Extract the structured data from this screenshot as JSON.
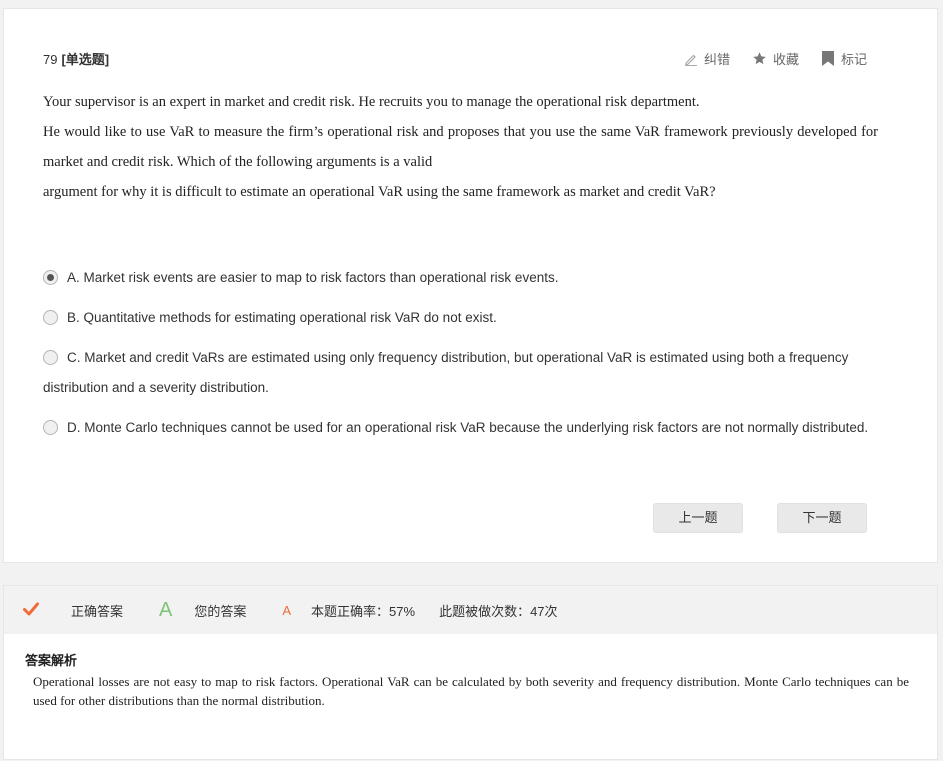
{
  "question": {
    "number": "79",
    "type_label": "[单选题]",
    "stem": [
      "Your supervisor is an expert in market and credit risk. He recruits you to manage the operational risk department.",
      "He would like to use VaR to measure the firm’s operational risk and proposes that you use the same VaR framework previously developed for market and credit risk. Which of the following arguments is a valid",
      "argument for why it is difficult to estimate an operational VaR using the same framework as market and credit VaR?"
    ],
    "options": [
      {
        "text": "A. Market risk events are easier to map to risk factors than operational risk events.",
        "selected": true
      },
      {
        "text": "B. Quantitative methods for estimating operational risk VaR do not exist.",
        "selected": false
      },
      {
        "text": "C. Market and credit VaRs are estimated using only frequency distribution, but operational VaR is estimated using both a frequency distribution and a severity distribution.",
        "selected": false
      },
      {
        "text": "D. Monte Carlo techniques cannot be used for an operational risk VaR because the underlying risk factors are not normally distributed.",
        "selected": false
      }
    ]
  },
  "tools": {
    "report_label": "纠错",
    "favorite_label": "收藏",
    "mark_label": "标记",
    "report_icon": "pencil-icon",
    "favorite_icon": "star-icon",
    "mark_icon": "bookmark-icon"
  },
  "nav": {
    "prev_label": "上一题",
    "next_label": "下一题"
  },
  "result": {
    "correct_label": "正确答案",
    "correct_value": "A",
    "your_label": "您的答案",
    "your_value": "A",
    "accuracy_text": "本题正确率：57%",
    "attempts_text": "此题被做次数：47次",
    "check_icon": "checkmark-icon"
  },
  "explanation": {
    "title": "答案解析",
    "text": "Operational losses are not easy to map to risk factors. Operational VaR can be calculated by both severity and frequency distribution. Monte Carlo techniques can be used for other distributions than the normal distribution."
  },
  "colors": {
    "correct_green": "#7cc576",
    "accent_orange": "#f06a3a",
    "card_bg": "#ffffff",
    "page_bg": "#f2f2f2"
  }
}
